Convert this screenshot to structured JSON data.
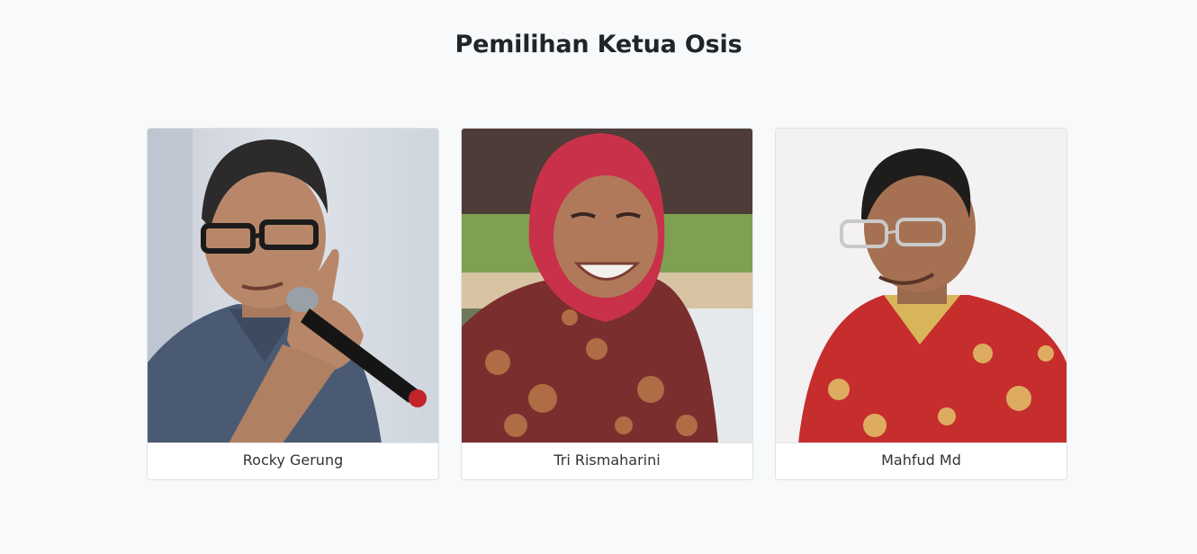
{
  "page": {
    "title": "Pemilihan Ketua Osis"
  },
  "candidates": [
    {
      "name": "Rocky Gerung",
      "photo": "candidate-photo-rocky"
    },
    {
      "name": "Tri Rismaharini",
      "photo": "candidate-photo-tri"
    },
    {
      "name": "Mahfud Md",
      "photo": "candidate-photo-mahfud"
    }
  ],
  "colors": {
    "background": "#f8f9fa",
    "card_border": "#dee2e6",
    "title_text": "#212529"
  }
}
